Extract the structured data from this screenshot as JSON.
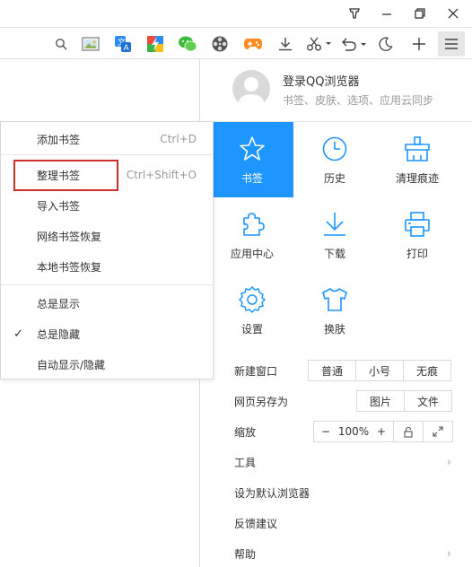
{
  "titlebar": {
    "icons": [
      "skin-icon",
      "minimize-icon",
      "restore-icon",
      "close-icon"
    ]
  },
  "toolbar": {
    "icons": [
      "search-icon",
      "screenshot-image-icon",
      "translate-icon",
      "game-icon",
      "wechat-icon",
      "video-icon",
      "gamepad-icon",
      "download-icon",
      "scissors-icon",
      "undo-icon",
      "night-mode-icon",
      "add-icon",
      "menu-icon"
    ]
  },
  "login": {
    "title": "登录QQ浏览器",
    "subtitle": "书签、皮肤、选项、应用云同步"
  },
  "grid": [
    {
      "label": "书签",
      "icon": "star-icon"
    },
    {
      "label": "历史",
      "icon": "clock-icon"
    },
    {
      "label": "清理痕迹",
      "icon": "broom-icon"
    },
    {
      "label": "应用中心",
      "icon": "puzzle-icon"
    },
    {
      "label": "下载",
      "icon": "download-icon"
    },
    {
      "label": "打印",
      "icon": "printer-icon"
    },
    {
      "label": "设置",
      "icon": "gear-icon"
    },
    {
      "label": "换肤",
      "icon": "shirt-icon"
    }
  ],
  "new_window": {
    "label": "新建窗口",
    "options": [
      "普通",
      "小号",
      "无痕"
    ]
  },
  "save_as": {
    "label": "网页另存为",
    "options": [
      "图片",
      "文件"
    ]
  },
  "zoom": {
    "label": "缩放",
    "minus": "−",
    "value": "100%",
    "plus": "+"
  },
  "menu_rows": [
    "工具",
    "设为默认浏览器",
    "反馈建议",
    "帮助"
  ],
  "chevron": "›",
  "dropdown": {
    "items": [
      {
        "label": "添加书签",
        "shortcut": "Ctrl+D"
      },
      {
        "label": "整理书签",
        "shortcut": "Ctrl+Shift+O"
      },
      {
        "label": "导入书签",
        "shortcut": ""
      },
      {
        "label": "网络书签恢复",
        "shortcut": ""
      },
      {
        "label": "本地书签恢复",
        "shortcut": ""
      },
      {
        "label": "总是显示",
        "shortcut": ""
      },
      {
        "label": "总是隐藏",
        "shortcut": "",
        "checked": true
      },
      {
        "label": "自动显示/隐藏",
        "shortcut": ""
      }
    ],
    "check_mark": "✓"
  },
  "colors": {
    "accent": "#1e96ff",
    "highlight": "#c9302c"
  }
}
